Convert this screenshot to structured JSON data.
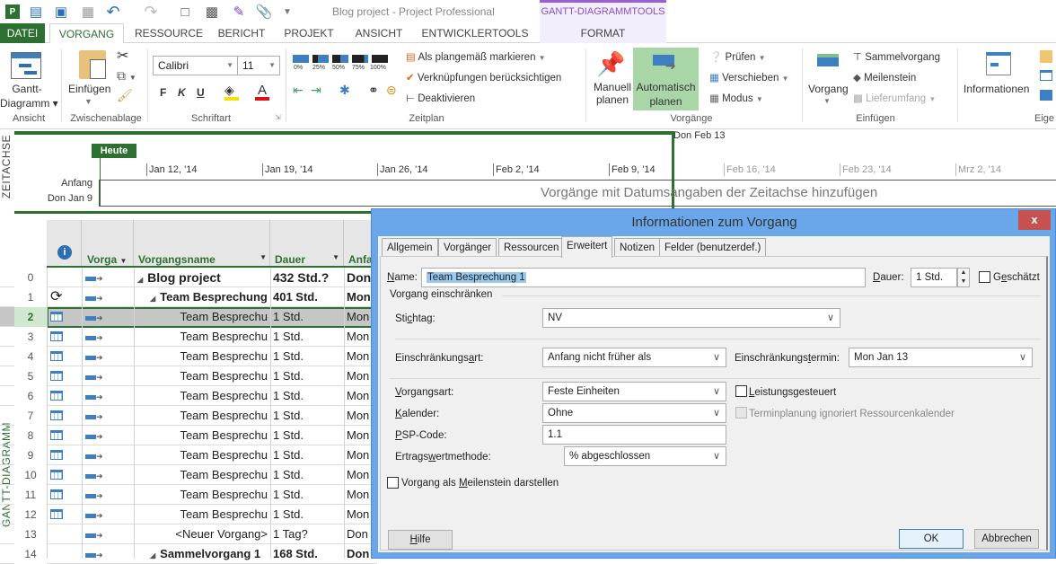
{
  "window": {
    "title": "Blog project - Project Professional",
    "context_group": "GANTT-DIAGRAMMTOOLS"
  },
  "qat": {
    "icons": [
      "project-logo-icon",
      "new-task-icon",
      "print-preview-icon",
      "publish-icon",
      "undo-icon",
      "redo-icon",
      "new-document-icon",
      "save-icon",
      "edit-icon",
      "attach-icon",
      "customize-qat-icon"
    ]
  },
  "tabs": [
    {
      "label": "DATEI"
    },
    {
      "label": "VORGANG",
      "active": true
    },
    {
      "label": "RESSOURCE"
    },
    {
      "label": "BERICHT"
    },
    {
      "label": "PROJEKT"
    },
    {
      "label": "ANSICHT"
    },
    {
      "label": "ENTWICKLERTOOLS"
    },
    {
      "label": "FORMAT"
    }
  ],
  "ribbon": {
    "ansicht": {
      "label": "Ansicht",
      "gantt_line1": "Gantt-",
      "gantt_line2": "Diagramm"
    },
    "zwischenablage": {
      "label": "Zwischenablage",
      "paste": "Einfügen"
    },
    "schriftart": {
      "label": "Schriftart",
      "font": "Calibri",
      "size": "11",
      "bold": "F",
      "italic": "K",
      "underline": "U"
    },
    "zeitplan": {
      "label": "Zeitplan",
      "percent": [
        "0%",
        "25%",
        "50%",
        "75%",
        "100%"
      ],
      "mark_on_track": "Als plangemäß markieren",
      "respect_links": "Verknüpfungen berücksichtigen",
      "deactivate": "Deaktivieren"
    },
    "vorgaenge": {
      "label": "Vorgänge",
      "manual_1": "Manuell",
      "manual_2": "planen",
      "auto_1": "Automatisch",
      "auto_2": "planen",
      "inspect": "Prüfen",
      "move": "Verschieben",
      "mode": "Modus"
    },
    "einfuegen": {
      "label": "Einfügen",
      "task": "Vorgang",
      "summary": "Sammelvorgang",
      "milestone": "Meilenstein",
      "deliverable": "Lieferumfang"
    },
    "eigenschaften": {
      "label": "Eige",
      "info": "Informationen"
    }
  },
  "timeline": {
    "side_label": "ZEITACHSE",
    "today": "Heute",
    "start_label": "Anfang",
    "start_date": "Don Jan 9",
    "end_date": "Don Feb 13",
    "ticks": [
      "Jan 12, '14",
      "Jan 19, '14",
      "Jan 26, '14",
      "Feb 2, '14",
      "Feb 9, '14",
      "Feb 16, '14",
      "Feb 23, '14",
      "Mrz 2, '14"
    ],
    "placeholder": "Vorgänge mit Datumsangaben der Zeitachse hinzufügen"
  },
  "grid": {
    "side_label": "GANTT-DIAGRAMM",
    "columns": [
      "Vorga",
      "Vorgangsname",
      "Dauer",
      "Anfa"
    ],
    "rows": [
      {
        "id": "0",
        "indicator": "",
        "name": "Blog project",
        "duration": "432 Std.?",
        "start": "Don",
        "level": 0,
        "summary": true
      },
      {
        "id": "1",
        "indicator": "recurring",
        "name": "Team Besprechung",
        "duration": "401 Std.",
        "start": "Mon",
        "level": 1,
        "summary": true
      },
      {
        "id": "2",
        "indicator": "calendar",
        "name": "Team Besprechu",
        "duration": "1 Std.",
        "start": "Mon",
        "level": 2,
        "selected": true
      },
      {
        "id": "3",
        "indicator": "calendar",
        "name": "Team Besprechu",
        "duration": "1 Std.",
        "start": "Mon",
        "level": 2
      },
      {
        "id": "4",
        "indicator": "calendar",
        "name": "Team Besprechu",
        "duration": "1 Std.",
        "start": "Mon",
        "level": 2
      },
      {
        "id": "5",
        "indicator": "calendar",
        "name": "Team Besprechu",
        "duration": "1 Std.",
        "start": "Mon",
        "level": 2
      },
      {
        "id": "6",
        "indicator": "calendar",
        "name": "Team Besprechu",
        "duration": "1 Std.",
        "start": "Mon",
        "level": 2
      },
      {
        "id": "7",
        "indicator": "calendar",
        "name": "Team Besprechu",
        "duration": "1 Std.",
        "start": "Mon",
        "level": 2
      },
      {
        "id": "8",
        "indicator": "calendar",
        "name": "Team Besprechu",
        "duration": "1 Std.",
        "start": "Mon",
        "level": 2
      },
      {
        "id": "9",
        "indicator": "calendar",
        "name": "Team Besprechu",
        "duration": "1 Std.",
        "start": "Mon",
        "level": 2
      },
      {
        "id": "10",
        "indicator": "calendar",
        "name": "Team Besprechu",
        "duration": "1 Std.",
        "start": "Mon",
        "level": 2
      },
      {
        "id": "11",
        "indicator": "calendar",
        "name": "Team Besprechu",
        "duration": "1 Std.",
        "start": "Mon",
        "level": 2
      },
      {
        "id": "12",
        "indicator": "calendar",
        "name": "Team Besprechu",
        "duration": "1 Std.",
        "start": "Mon",
        "level": 2
      },
      {
        "id": "13",
        "indicator": "",
        "name": "<Neuer Vorgang>",
        "duration": "1 Tag?",
        "start": "Don",
        "level": 2
      },
      {
        "id": "14",
        "indicator": "",
        "name": "Sammelvorgang 1",
        "duration": "168 Std.",
        "start": "Don",
        "level": 1,
        "summary": true
      }
    ]
  },
  "dialog": {
    "title": "Informationen zum Vorgang",
    "close": "x",
    "tabs": [
      "Allgemein",
      "Vorgänger",
      "Ressourcen",
      "Erweitert",
      "Notizen",
      "Felder (benutzerdef.)"
    ],
    "active_tab": "Erweitert",
    "name_label": "Name:",
    "name_value": "Team Besprechung 1",
    "duration_label": "Dauer:",
    "duration_value": "1 Std.",
    "estimated_label": "Geschätzt",
    "estimated_checked": false,
    "constrain_section": "Vorgang einschränken",
    "deadline_label": "Stichtag:",
    "deadline_value": "NV",
    "constraint_type_label": "Einschränkungsart:",
    "constraint_type_value": "Anfang nicht früher als",
    "constraint_date_label": "Einschränkungstermin:",
    "constraint_date_value": "Mon Jan 13",
    "task_type_label": "Vorgangsart:",
    "task_type_value": "Feste Einheiten",
    "effort_driven_label": "Leistungsgesteuert",
    "effort_driven_checked": false,
    "calendar_label": "Kalender:",
    "calendar_value": "Ohne",
    "ignore_res_cal_label": "Terminplanung ignoriert Ressourcenkalender",
    "ignore_res_cal_disabled": true,
    "wbs_label": "PSP-Code:",
    "wbs_value": "1.1",
    "earned_value_label": "Ertragswertmethode:",
    "earned_value_value": "% abgeschlossen",
    "milestone_label": "Vorgang als Meilenstein darstellen",
    "milestone_checked": false,
    "help_button": "Hilfe",
    "ok_button": "OK",
    "cancel_button": "Abbrechen"
  },
  "colors": {
    "accent_green": "#2e7032",
    "dialog_blue": "#6aa7ea",
    "close_red": "#c75050",
    "context_purple": "#8b4fc7"
  }
}
